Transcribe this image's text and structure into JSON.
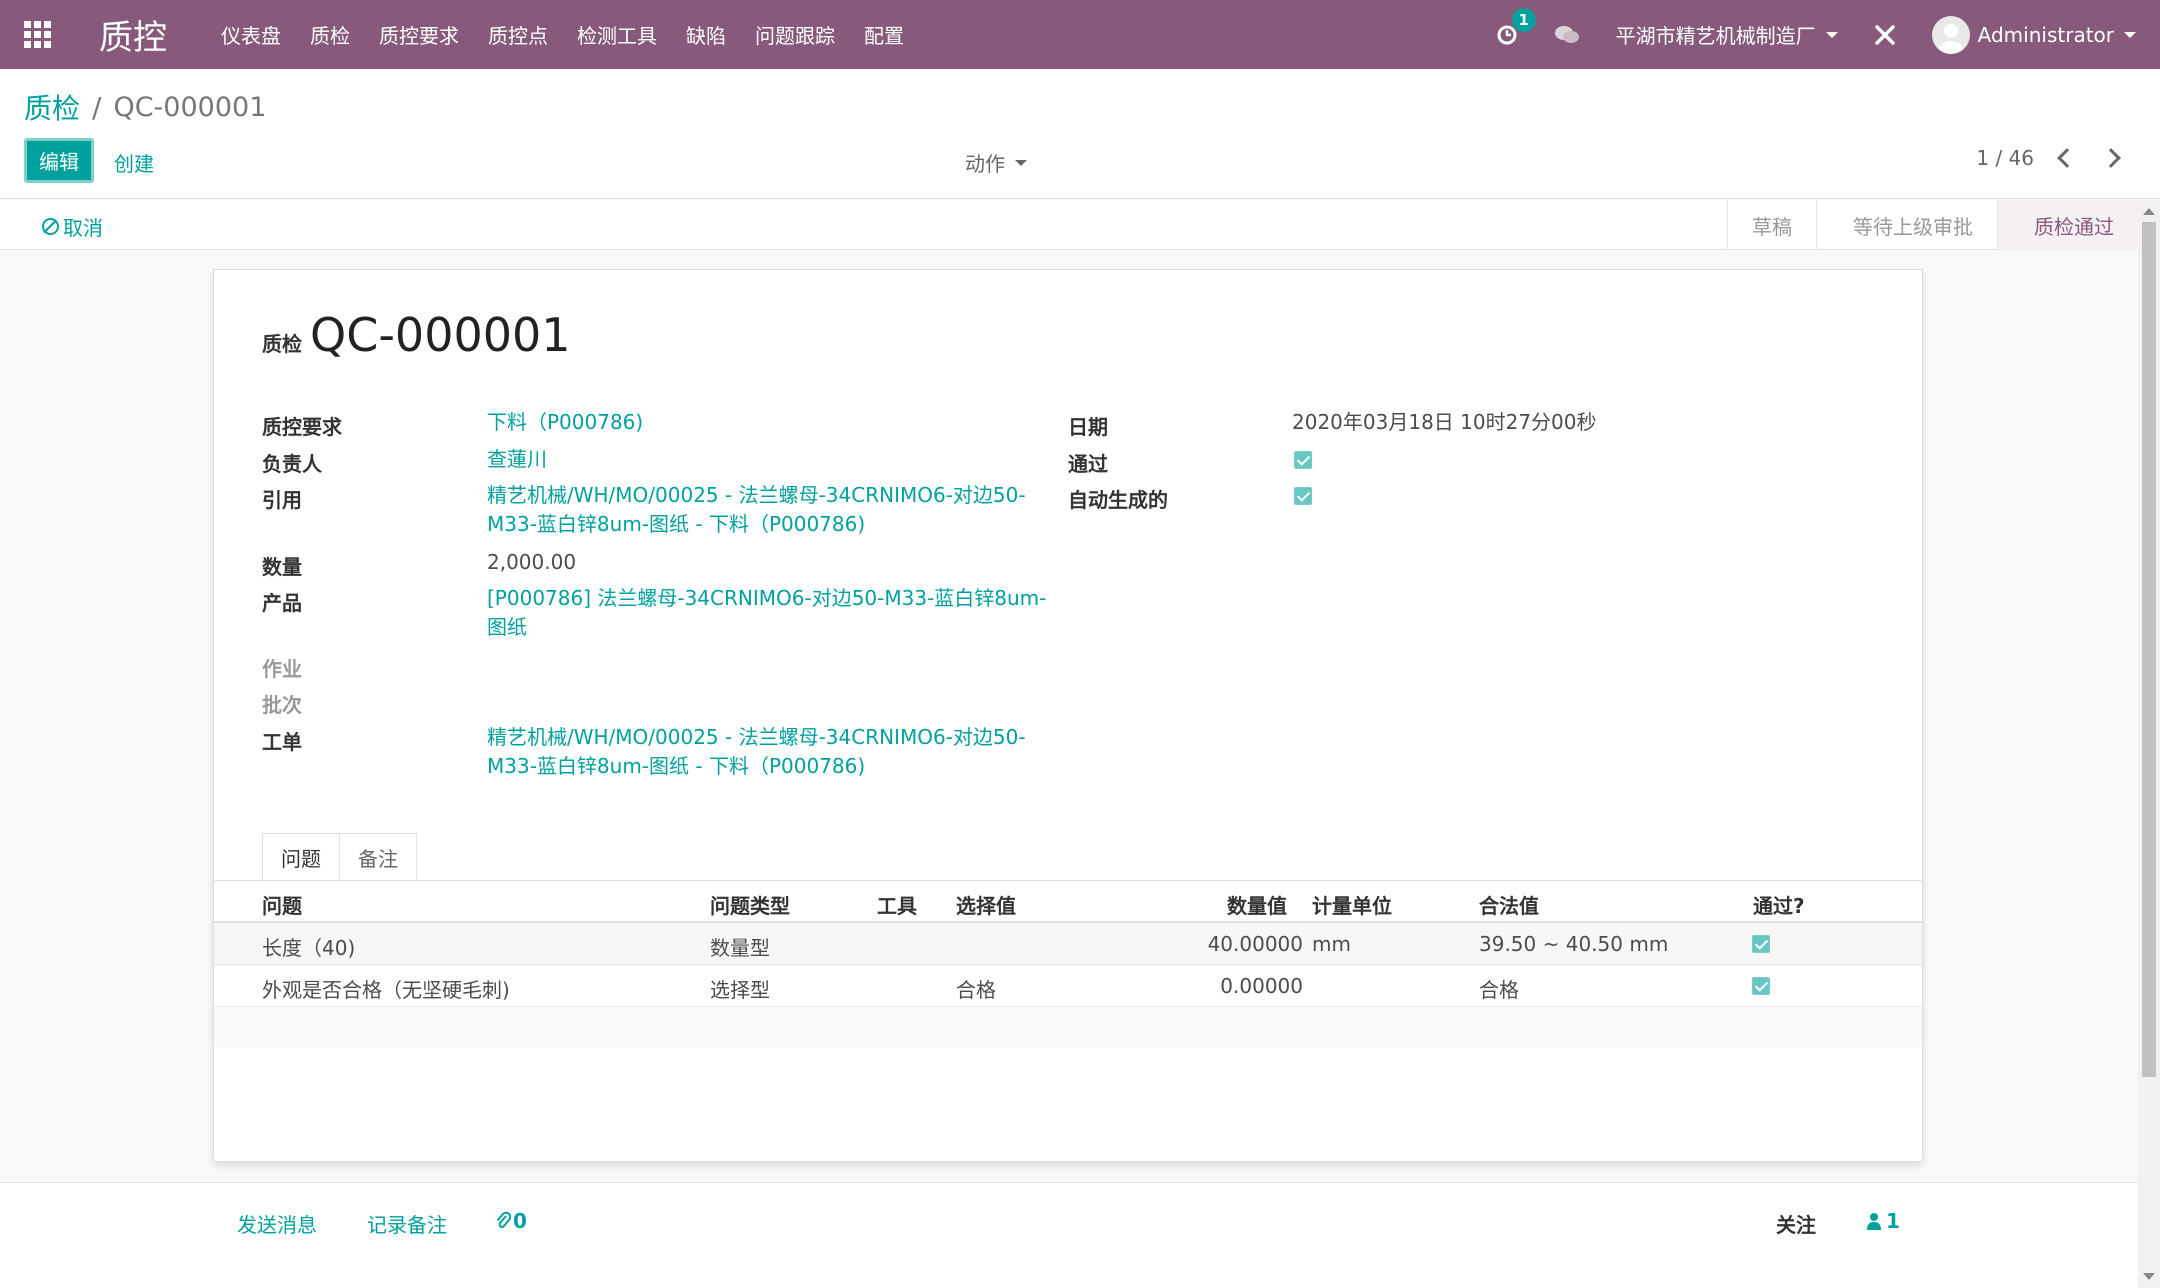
{
  "navbar": {
    "brand": "质控",
    "menu": [
      "仪表盘",
      "质检",
      "质控要求",
      "质控点",
      "检测工具",
      "缺陷",
      "问题跟踪",
      "配置"
    ],
    "activity_count": "1",
    "company": "平湖市精艺机械制造厂",
    "user": "Administrator"
  },
  "breadcrumb": {
    "parent": "质检",
    "current": "QC-000001"
  },
  "toolbar": {
    "edit": "编辑",
    "create": "创建",
    "actions": "动作",
    "pager": "1 / 46"
  },
  "statusbar": {
    "cancel": "取消",
    "stages": [
      "草稿",
      "等待上级审批",
      "质检通过"
    ],
    "active_stage": "质检通过"
  },
  "record": {
    "title_prefix": "质检",
    "title": "QC-000001",
    "labels": {
      "requirement": "质控要求",
      "responsible": "负责人",
      "reference": "引用",
      "quantity": "数量",
      "product": "产品",
      "operation": "作业",
      "lot": "批次",
      "workorder": "工单",
      "date": "日期",
      "passed": "通过",
      "auto_generated": "自动生成的"
    },
    "values": {
      "requirement": "下料（P000786)",
      "responsible": "查蓮川",
      "reference_line1": "精艺机械/WH/MO/00025 - 法兰螺母-34CRNIMO6-对边50-",
      "reference_line2": "M33-蓝白锌8um-图纸 - 下料（P000786)",
      "quantity": "2,000.00",
      "product_line1": "[P000786] 法兰螺母-34CRNIMO6-对边50-M33-蓝白锌8um-",
      "product_line2": "图纸",
      "workorder_line1": "精艺机械/WH/MO/00025 - 法兰螺母-34CRNIMO6-对边50-",
      "workorder_line2": "M33-蓝白锌8um-图纸 - 下料（P000786)",
      "date": "2020年03月18日 10时27分00秒"
    }
  },
  "tabs": [
    "问题",
    "备注"
  ],
  "table": {
    "headers": [
      "问题",
      "问题类型",
      "工具",
      "选择值",
      "数量值",
      "计量单位",
      "合法值",
      "通过?"
    ],
    "rows": [
      {
        "question": "长度（40)",
        "type": "数量型",
        "tool": "",
        "choice": "",
        "qty": "40.00000",
        "uom": "mm",
        "legal": "39.50 ~ 40.50 mm"
      },
      {
        "question": "外观是否合格（无坚硬毛刺)",
        "type": "选择型",
        "tool": "",
        "choice": "合格",
        "qty": "0.00000",
        "uom": "",
        "legal": "合格"
      }
    ]
  },
  "chatter": {
    "send": "发送消息",
    "log": "记录备注",
    "attachments": "0",
    "follow": "关注",
    "followers": "1"
  },
  "colors": {
    "brand": "#875a7b",
    "accent": "#00a09d"
  }
}
